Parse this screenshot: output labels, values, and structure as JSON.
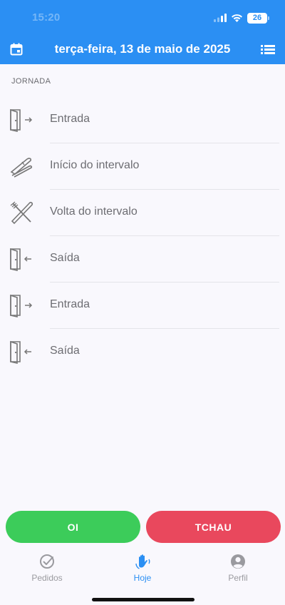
{
  "status_bar": {
    "time": "15:20",
    "battery": "26"
  },
  "header": {
    "title": "terça-feira, 13 de maio de 2025",
    "calendar_icon": "calendar-icon",
    "menu_icon": "list-icon"
  },
  "section_label": "JORNADA",
  "entries": [
    {
      "label": "Entrada",
      "icon": "door-enter-icon"
    },
    {
      "label": "Início do intervalo",
      "icon": "fork-knife-icon"
    },
    {
      "label": "Volta do intervalo",
      "icon": "fork-knife-crossed-icon"
    },
    {
      "label": "Saída",
      "icon": "door-exit-icon"
    },
    {
      "label": "Entrada",
      "icon": "door-enter-icon"
    },
    {
      "label": "Saída",
      "icon": "door-exit-icon"
    }
  ],
  "actions": {
    "oi_label": "OI",
    "tchau_label": "TCHAU"
  },
  "tabs": [
    {
      "label": "Pedidos",
      "icon": "check-circle-icon"
    },
    {
      "label": "Hoje",
      "icon": "hand-icon",
      "active": true
    },
    {
      "label": "Perfil",
      "icon": "user-circle-icon"
    }
  ],
  "colors": {
    "primary": "#2b8ff3",
    "green": "#3ccc5a",
    "red": "#e9485d"
  }
}
